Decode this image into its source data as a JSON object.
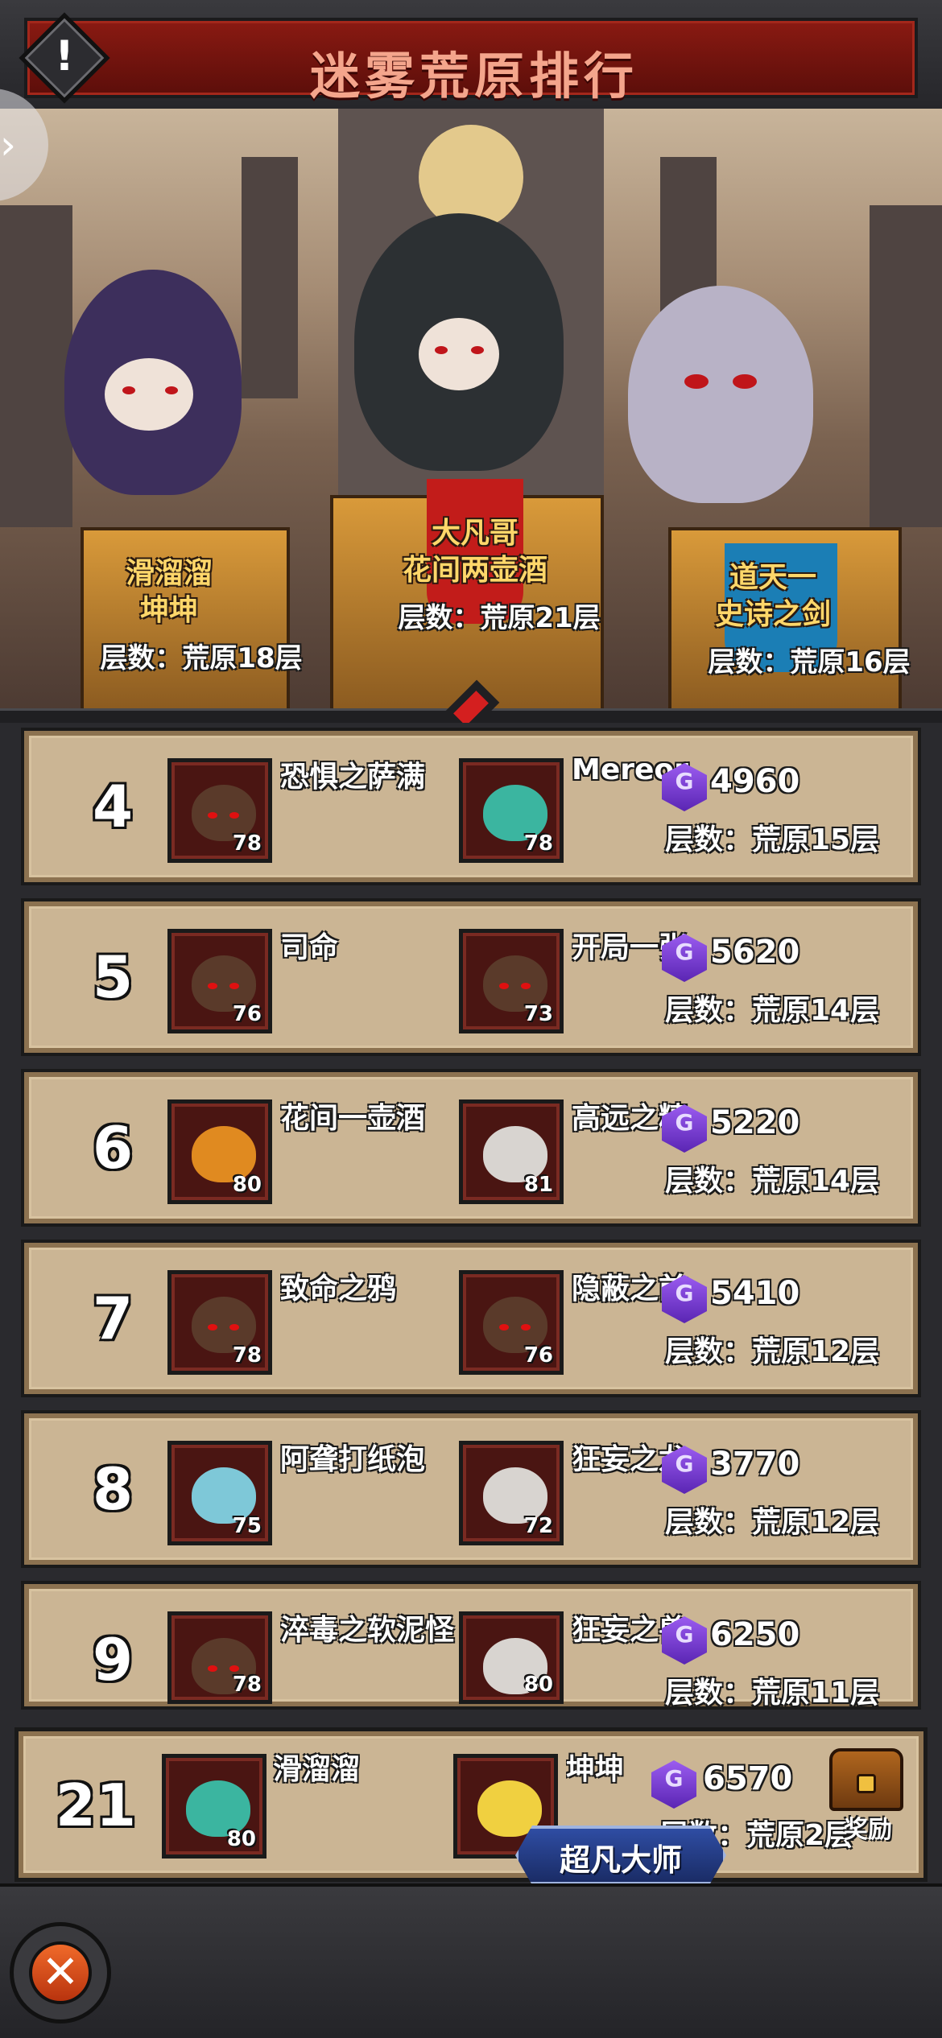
{
  "title": "迷雾荒原排行",
  "podium": [
    {
      "place": "second",
      "name_line1": "滑溜溜",
      "name_line2": "坤坤",
      "floor": "层数：荒原18层"
    },
    {
      "place": "first",
      "name_line1": "大凡哥",
      "name_line2": "花间两壶酒",
      "floor": "层数：荒原21层"
    },
    {
      "place": "third",
      "name_line1": "道天一",
      "name_line2": "史诗之剑",
      "floor": "层数：荒原16层"
    }
  ],
  "rows": [
    {
      "rank": "4",
      "p1": {
        "name": "恐惧之萨满",
        "level": "78"
      },
      "p2": {
        "name": "Mereor",
        "level": "78"
      },
      "power": "4960",
      "floor": "层数：荒原15层"
    },
    {
      "rank": "5",
      "p1": {
        "name": "司命",
        "level": "76"
      },
      "p2": {
        "name": "开局一张",
        "level": "73"
      },
      "power": "5620",
      "floor": "层数：荒原14层"
    },
    {
      "rank": "6",
      "p1": {
        "name": "花间一壶酒",
        "level": "80"
      },
      "p2": {
        "name": "高远之精",
        "level": "81"
      },
      "power": "5220",
      "floor": "层数：荒原14层"
    },
    {
      "rank": "7",
      "p1": {
        "name": "致命之鸦",
        "level": "78"
      },
      "p2": {
        "name": "隐蔽之前",
        "level": "76"
      },
      "power": "5410",
      "floor": "层数：荒原12层"
    },
    {
      "rank": "8",
      "p1": {
        "name": "阿聋打纸泡",
        "level": "75"
      },
      "p2": {
        "name": "狂妄之龙",
        "level": "72"
      },
      "power": "3770",
      "floor": "层数：荒原12层"
    },
    {
      "rank": "9",
      "p1": {
        "name": "淬毒之软泥怪",
        "level": "78"
      },
      "p2": {
        "name": "狂妄之兽",
        "level": "80"
      },
      "power": "6250",
      "floor": "层数：荒原11层"
    }
  ],
  "self": {
    "rank": "21",
    "p1": {
      "name": "滑溜溜",
      "level": "80"
    },
    "p2": {
      "name": "坤坤"
    },
    "power": "6570",
    "floor": "层数：荒原2层",
    "reward_label": "奖励",
    "title_badge": "超凡大师"
  },
  "gem_glyph": "G",
  "icons": {
    "warning": "warning-icon",
    "side_tab": "chevron-right-icon",
    "close": "close-icon",
    "chest": "treasure-chest-icon",
    "gem": "purple-gem-icon"
  },
  "colors": {
    "title_banner": "#7a150f",
    "title_text": "#f4a58c",
    "row_bg": "#cbb594",
    "name_gold": "#ffd76a",
    "gem": "#7b3fe0"
  }
}
